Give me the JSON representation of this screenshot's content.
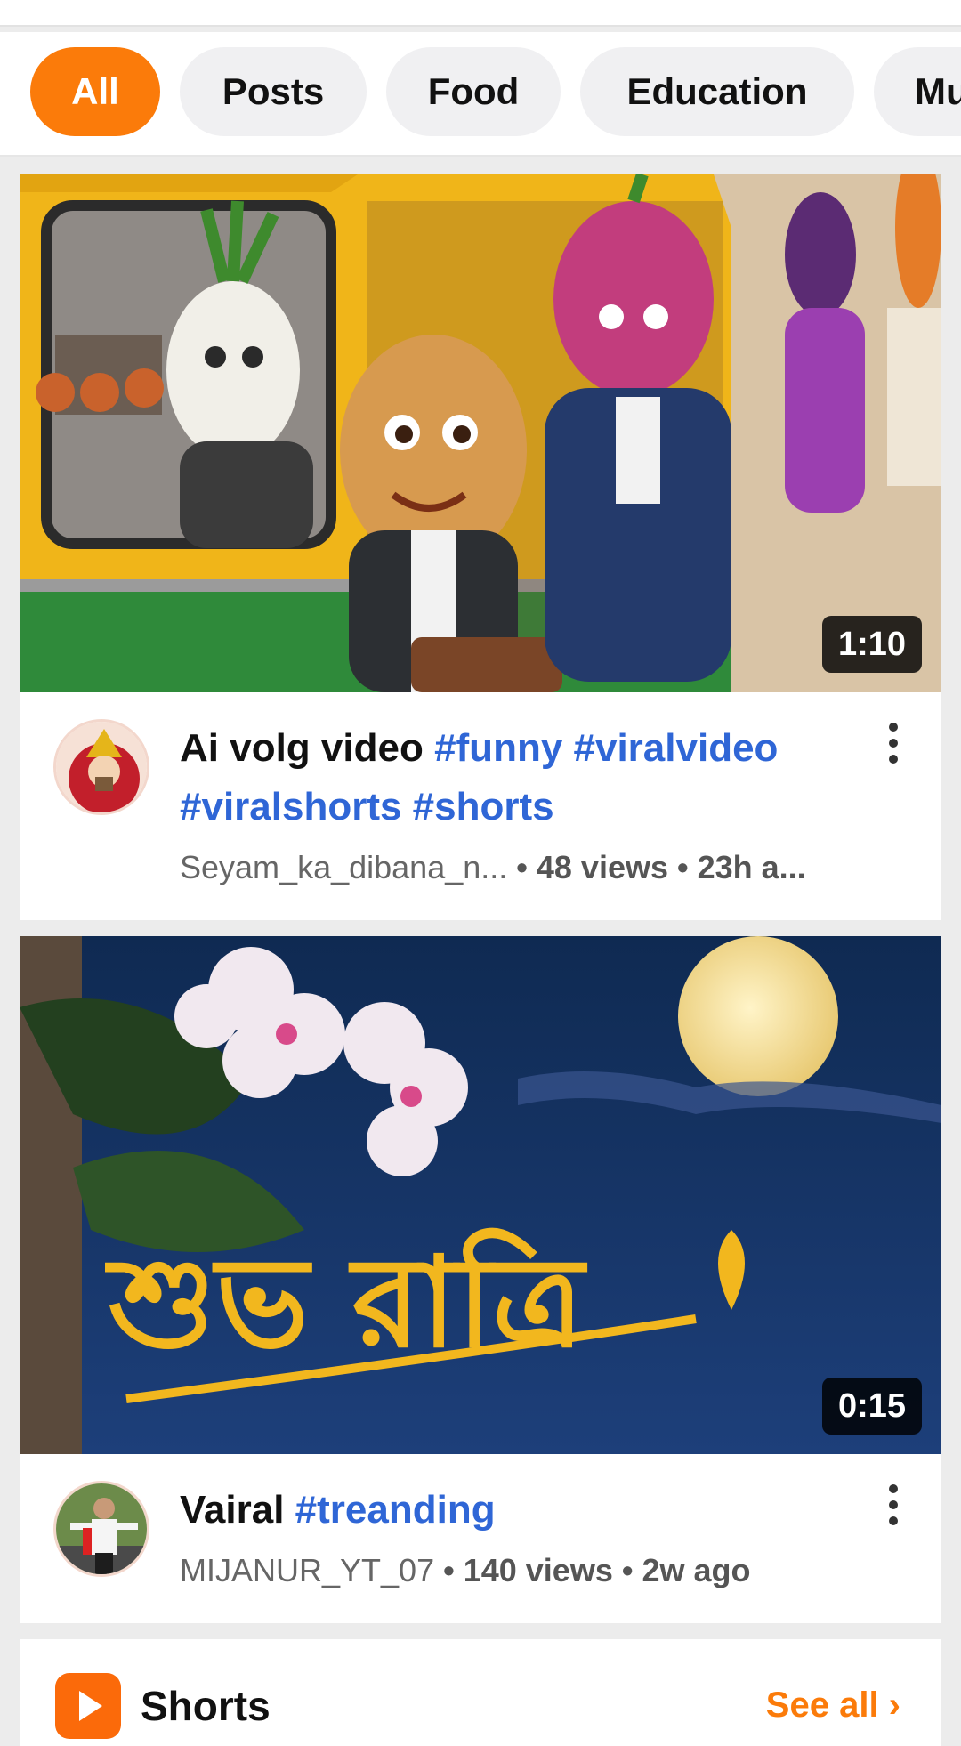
{
  "chips": [
    {
      "label": "All",
      "active": true
    },
    {
      "label": "Posts",
      "active": false
    },
    {
      "label": "Food",
      "active": false
    },
    {
      "label": "Education",
      "active": false
    },
    {
      "label": "Mu",
      "active": false
    }
  ],
  "videos": [
    {
      "title": "Ai volg video",
      "tags_line1": "#funny #viralvideo",
      "tags_line2": "#viralshorts #shorts",
      "channel": "Seyam_ka_dibana_n...",
      "stats": " • 48 views • 23h a...",
      "duration": "1:10",
      "thumbnail_icon": "vegetable-characters-auto-rickshaw-image"
    },
    {
      "title": "Vairal",
      "tags": "#treanding",
      "channel": "MIJANUR_YT_07",
      "stats": " • 140 views • 2w ago",
      "duration": "0:15",
      "overlay_text": "শুভ রাত্রি",
      "thumbnail_icon": "moonlit-flowers-image"
    }
  ],
  "shorts": {
    "title": "Shorts",
    "see_all": "See all ›"
  },
  "colors": {
    "accent": "#fb7b0a",
    "hashtag": "#2f66d6"
  }
}
